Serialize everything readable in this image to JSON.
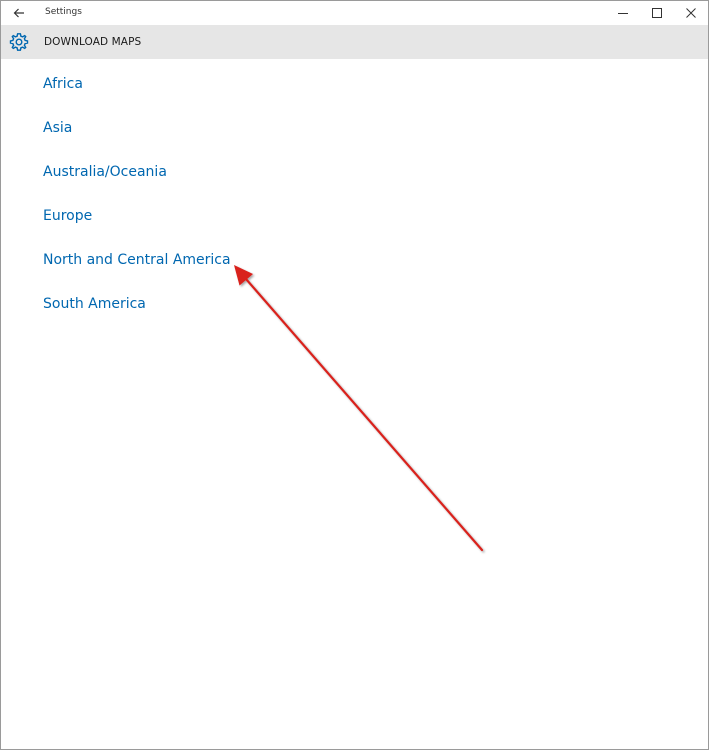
{
  "window": {
    "title": "Settings",
    "back_icon": "back-arrow-icon",
    "controls": [
      "minimize-icon",
      "maximize-icon",
      "close-icon"
    ]
  },
  "header": {
    "icon": "gear-icon",
    "title": "DOWNLOAD MAPS"
  },
  "regions": [
    "Africa",
    "Asia",
    "Australia/Oceania",
    "Europe",
    "North and Central America",
    "South America"
  ],
  "annotation": {
    "type": "arrow",
    "color": "#d9201c",
    "points_to": "North and Central America"
  },
  "colors": {
    "link": "#0067b0",
    "header_bg": "#e6e6e6",
    "gear": "#0067b0"
  }
}
